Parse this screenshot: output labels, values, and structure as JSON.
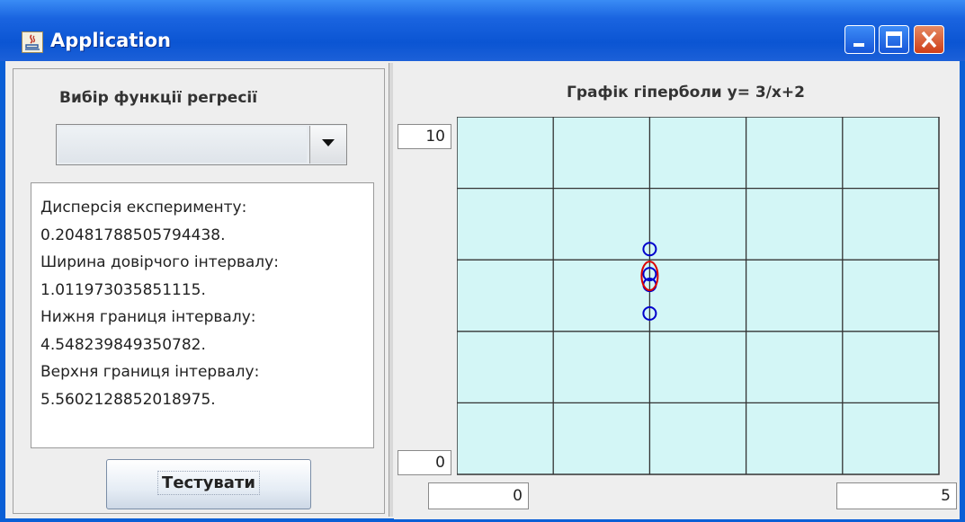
{
  "window": {
    "title": "Application",
    "buttons": {
      "minimize": "minimize",
      "maximize": "maximize",
      "close": "close"
    }
  },
  "left": {
    "regression_label": "Вибір функції регресії",
    "combo_value": "",
    "output_lines": [
      "Дисперсія експерименту:",
      "0.20481788505794438.",
      "Ширина довірчого інтервалу:",
      "1.011973035851115.",
      "Нижня границя інтервалу:",
      "4.548239849350782.",
      "Верхня границя інтервалу:",
      "5.5602128852018975."
    ],
    "test_button": "Тестувати"
  },
  "chart": {
    "title": "Графік гіперболи y= 3/x+2",
    "y_max_field": "10",
    "y_min_field": "0",
    "x_min_field": "0",
    "x_max_field": "5"
  },
  "chart_data": {
    "type": "scatter",
    "title": "Графік гіперболи y= 3/x+2",
    "xlim": [
      0,
      5
    ],
    "ylim": [
      0,
      10
    ],
    "grid": true,
    "background": "#d3f6f6",
    "series": [
      {
        "color": "#0000cc",
        "x": [
          2.0,
          2.0,
          2.0,
          2.0
        ],
        "y": [
          6.3,
          5.6,
          5.3,
          4.5
        ]
      },
      {
        "color": "#dd0000",
        "x": [
          2.0
        ],
        "y": [
          5.55
        ]
      }
    ]
  }
}
